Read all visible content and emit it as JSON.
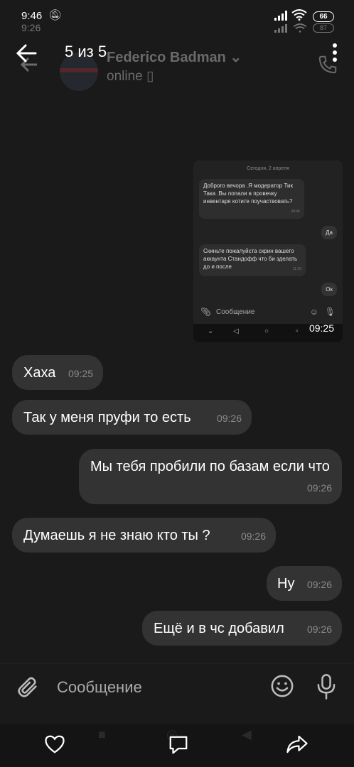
{
  "status_bar": {
    "time": "9:46",
    "time_ghost": "9:26",
    "battery": "66",
    "battery_ghost": "87"
  },
  "header": {
    "counter": "5 из 5",
    "contact_name": "Federico Badman ⌄",
    "contact_status": "online ▯"
  },
  "embedded_screenshot": {
    "date": "Сегодня, 2 апреля",
    "messages": [
      {
        "text": "Доброго вечора .Я модератор Тик Така .Вы попали в провечку инвентаря котите поучаствовать?",
        "time": "09:46"
      },
      {
        "text": "Да",
        "time": ""
      },
      {
        "text": "Скиньте пожалуйста скрин вашего аккаунта Стандофф что би зделать до и после",
        "time": "11:16"
      },
      {
        "text": "Ок",
        "time": ""
      }
    ],
    "input_placeholder": "Сообщение",
    "timestamp": "09:25"
  },
  "messages": [
    {
      "side": "in",
      "text": "Хаха",
      "time": "09:25"
    },
    {
      "side": "in",
      "text": "Так у меня пруфи то есть",
      "time": "09:26"
    },
    {
      "side": "out",
      "text": "Мы тебя пробили по базам если что",
      "time": "09:26"
    },
    {
      "side": "in",
      "text": "Думаешь я не знаю кто ты ?",
      "time": "09:26"
    },
    {
      "side": "out",
      "text": "Ну",
      "time": "09:26"
    },
    {
      "side": "out",
      "text": "Ещё и в чс добавил",
      "time": "09:26"
    }
  ],
  "input": {
    "placeholder": "Сообщение"
  },
  "icons": {
    "back": "arrow-left-icon",
    "more": "more-vertical-icon",
    "attach": "paperclip-icon",
    "emoji": "smile-icon",
    "mic": "microphone-icon",
    "like": "heart-icon",
    "comment": "comment-icon",
    "share": "share-icon"
  },
  "colors": {
    "background": "#1a1a1a",
    "bubble": "#333333",
    "accent_text": "#ffffff"
  }
}
